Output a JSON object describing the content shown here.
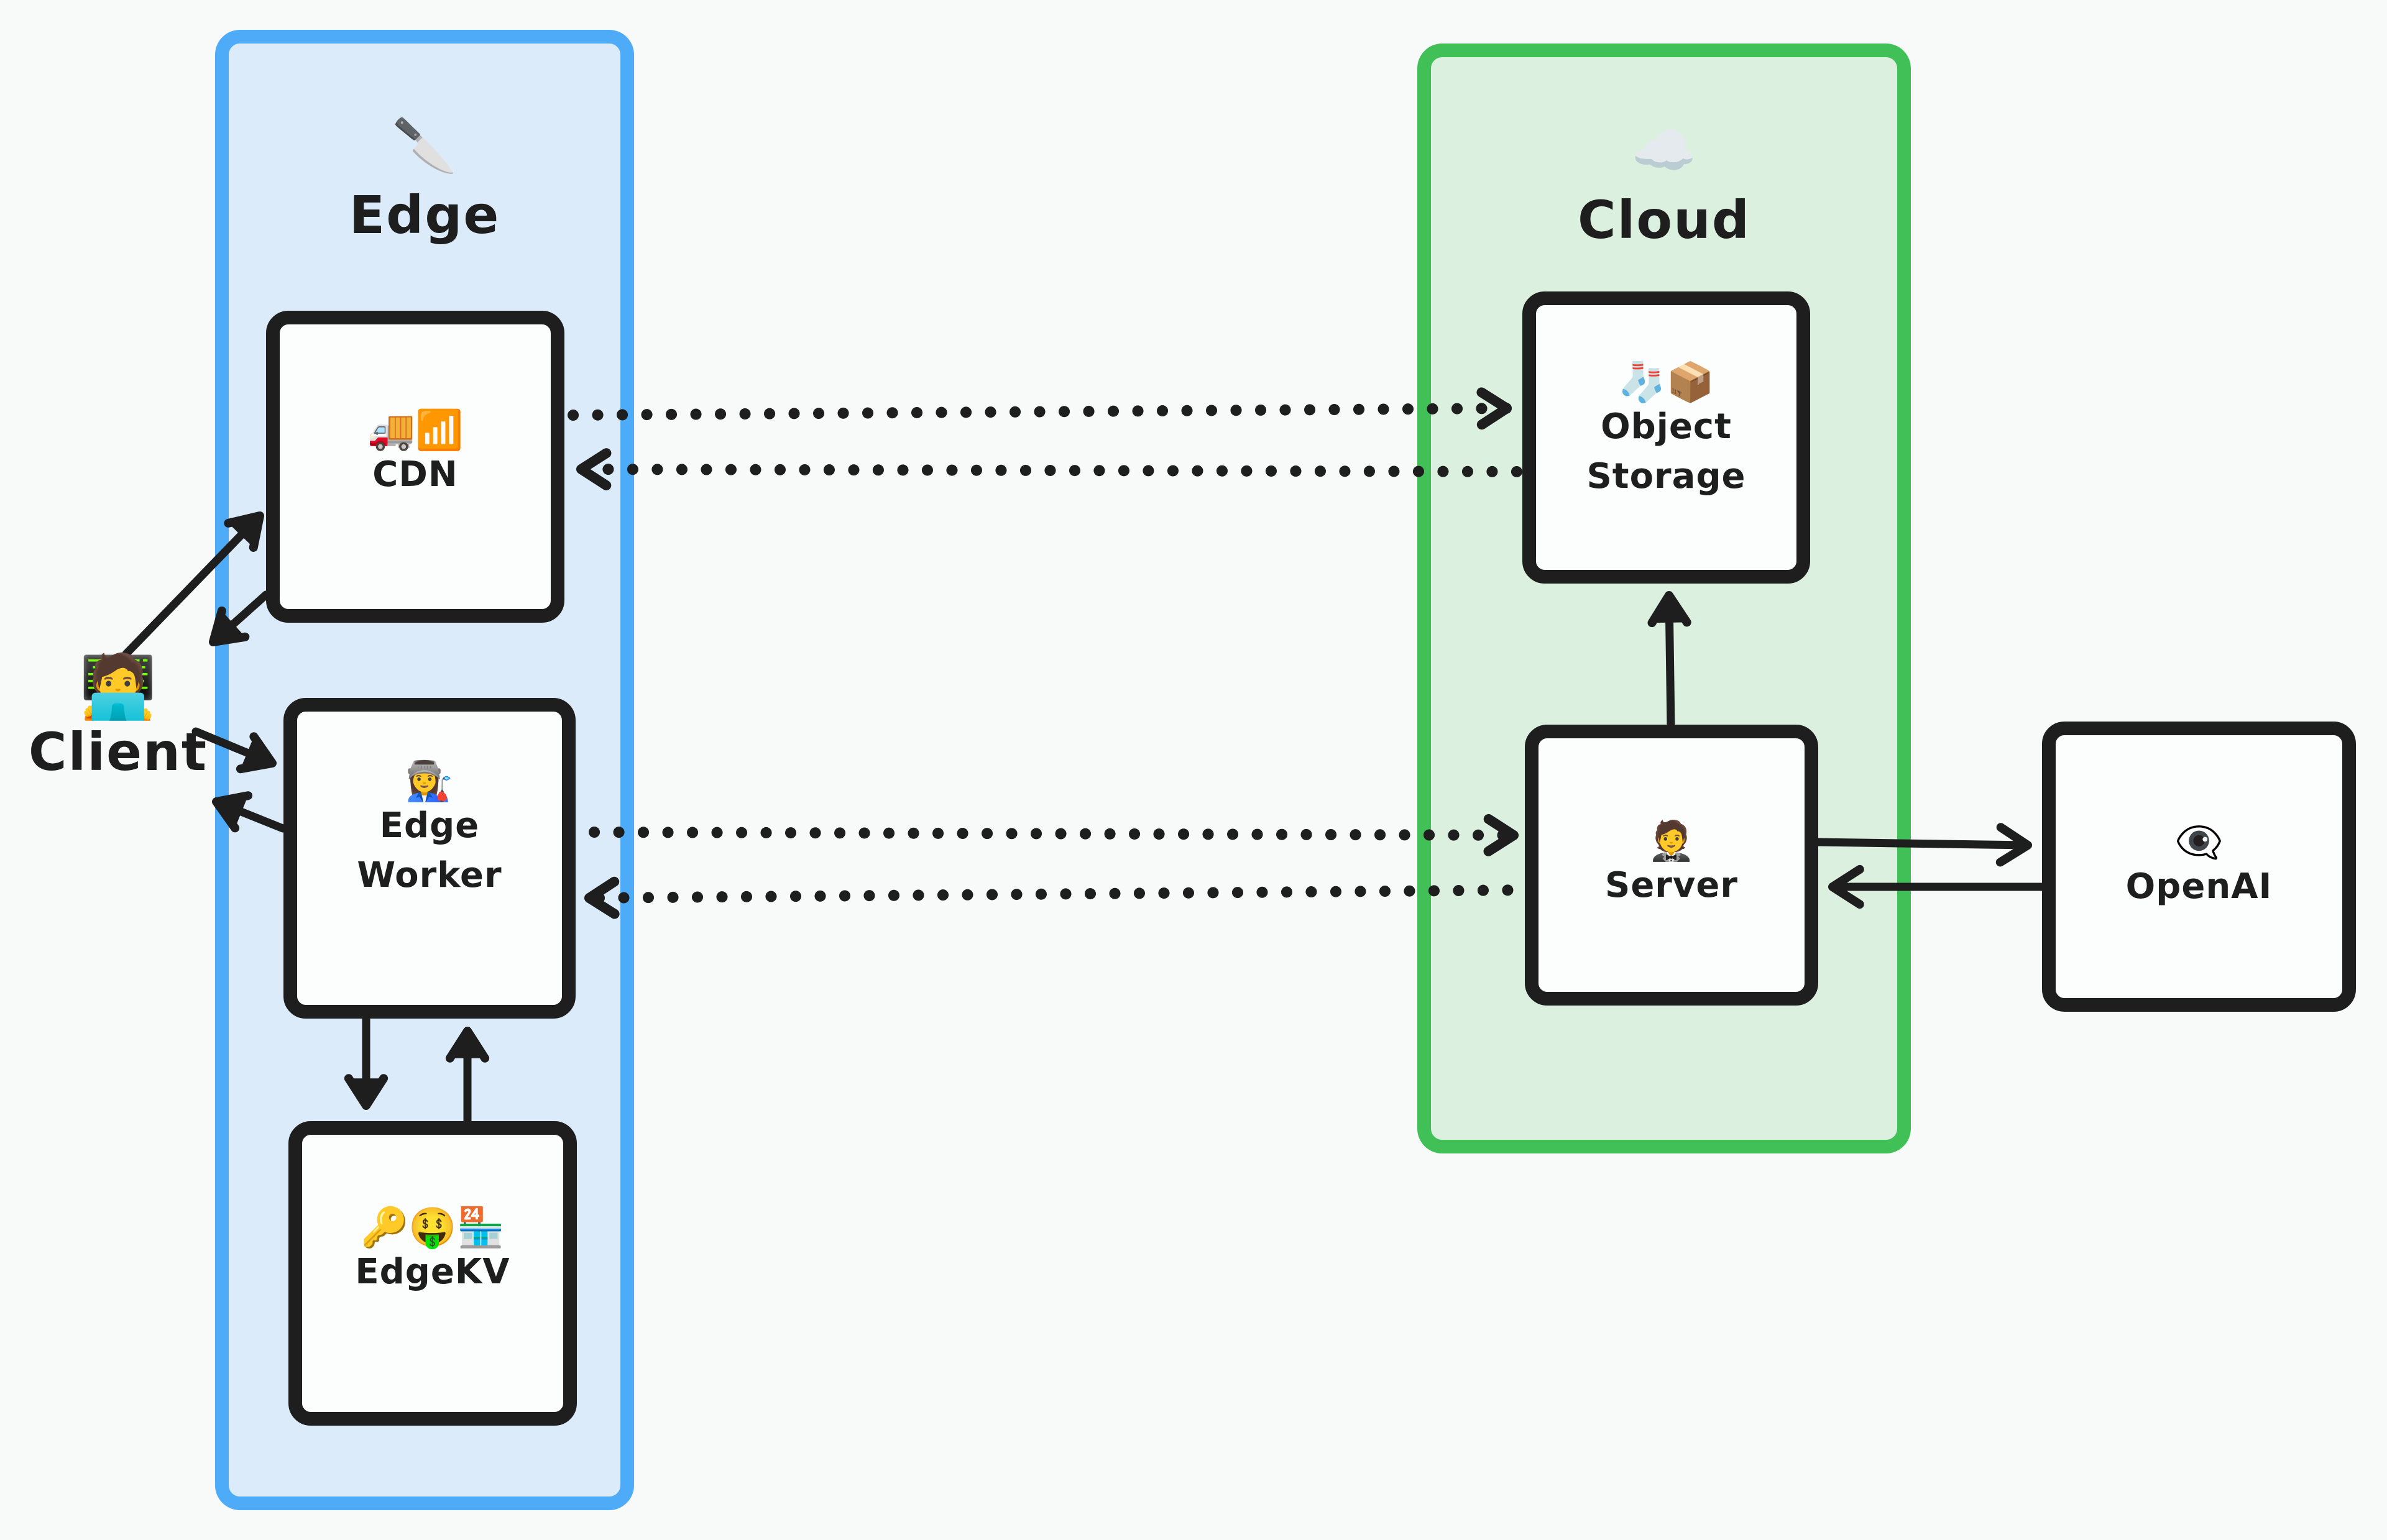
{
  "diagram": {
    "groups": {
      "edge": {
        "title": "Edge",
        "emoji": "🔪",
        "icon": "kitchen-knife-icon",
        "border_color": "#4dabf7",
        "fill_color": "#dbebf9"
      },
      "cloud": {
        "title": "Cloud",
        "emoji": "☁️",
        "icon": "cloud-icon",
        "border_color": "#40c057",
        "fill_color": "#dbf0df"
      }
    },
    "client": {
      "label": "Client",
      "emoji": "🧑‍💻",
      "icon": "technologist-icon"
    },
    "nodes": {
      "cdn": {
        "label": "CDN",
        "emoji": "🚚📶",
        "icons": [
          "delivery-truck-icon",
          "signal-bars-icon"
        ],
        "group": "edge"
      },
      "edge_worker": {
        "label": "Edge\nWorker",
        "emoji": "👩‍🏭",
        "icons": [
          "woman-factory-worker-icon"
        ],
        "group": "edge"
      },
      "edgekv": {
        "label": "EdgeKV",
        "emoji": "🔑🤑🏪",
        "icons": [
          "key-icon",
          "money-mouth-face-icon",
          "convenience-store-icon"
        ],
        "group": "edge"
      },
      "object_storage": {
        "label": "Object\nStorage",
        "emoji": "🧦📦",
        "icons": [
          "socks-icon",
          "package-icon"
        ],
        "group": "cloud"
      },
      "server": {
        "label": "Server",
        "emoji": "🤵",
        "icons": [
          "person-in-tuxedo-icon"
        ],
        "group": "cloud"
      },
      "openai": {
        "label": "OpenAI",
        "emoji": "👁️‍🗨️",
        "icons": [
          "eye-in-speech-bubble-icon"
        ],
        "group": null
      }
    },
    "connections": [
      {
        "from": "client",
        "to": "cdn",
        "style": "solid"
      },
      {
        "from": "cdn",
        "to": "client",
        "style": "solid"
      },
      {
        "from": "client",
        "to": "edge_worker",
        "style": "solid"
      },
      {
        "from": "edge_worker",
        "to": "client",
        "style": "solid"
      },
      {
        "from": "edge_worker",
        "to": "edgekv",
        "style": "solid"
      },
      {
        "from": "edgekv",
        "to": "edge_worker",
        "style": "solid"
      },
      {
        "from": "cdn",
        "to": "object_storage",
        "style": "dotted"
      },
      {
        "from": "object_storage",
        "to": "cdn",
        "style": "dotted"
      },
      {
        "from": "edge_worker",
        "to": "server",
        "style": "dotted"
      },
      {
        "from": "server",
        "to": "edge_worker",
        "style": "dotted"
      },
      {
        "from": "server",
        "to": "object_storage",
        "style": "solid"
      },
      {
        "from": "server",
        "to": "openai",
        "style": "solid"
      },
      {
        "from": "openai",
        "to": "server",
        "style": "solid"
      }
    ],
    "stroke_color": "#1e1e1e"
  }
}
